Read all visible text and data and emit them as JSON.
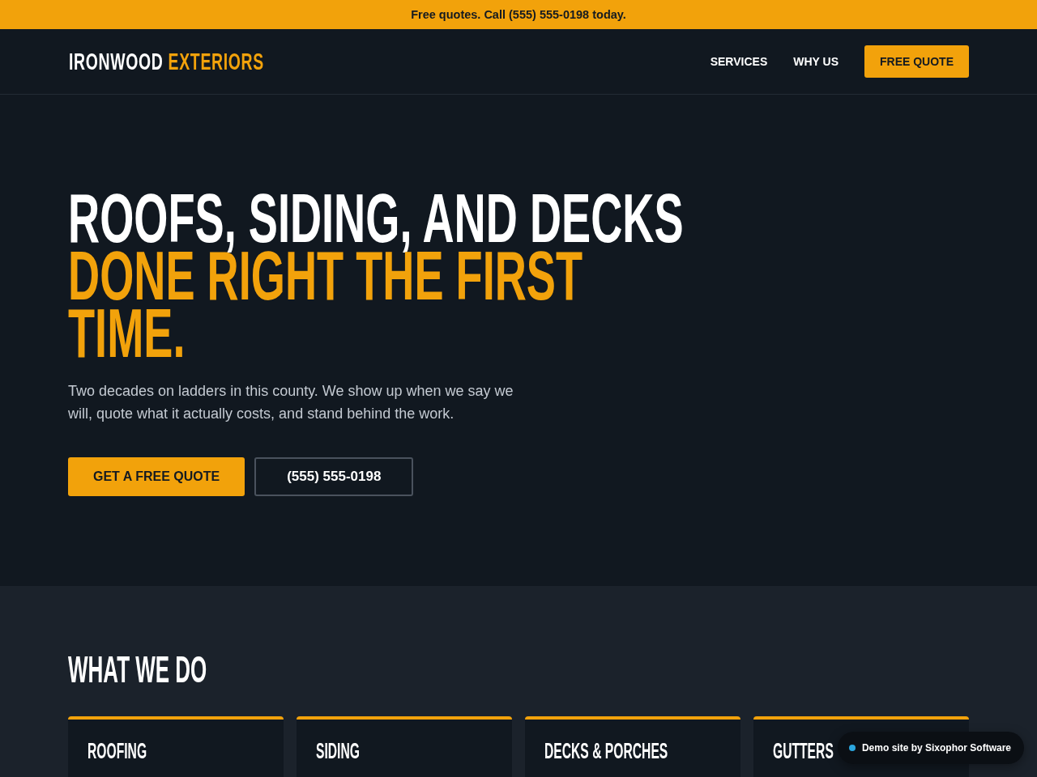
{
  "announcement_bar": {
    "text": "Free quotes. Call (555) 555-0198 today."
  },
  "header": {
    "logo": {
      "primary": "IRONWOOD",
      "accent": "EXTERIORS"
    },
    "nav": [
      {
        "label": "SERVICES",
        "kind": "link"
      },
      {
        "label": "WHY US",
        "kind": "link"
      },
      {
        "label": "FREE QUOTE",
        "kind": "button"
      }
    ]
  },
  "hero": {
    "headline": "ROOFS, SIDING, AND DECKS",
    "headline_highlight": "DONE RIGHT THE FIRST TIME.",
    "description": "Two decades on ladders in this county. We show up when we say we will, quote what it actually costs, and stand behind the work.",
    "actions": [
      {
        "label": "GET A FREE QUOTE",
        "kind": "primary"
      },
      {
        "label": "(555) 555-0198",
        "kind": "outline"
      }
    ]
  },
  "services": {
    "heading": "WHAT WE DO",
    "cards": [
      {
        "title": "ROOFING"
      },
      {
        "title": "SIDING"
      },
      {
        "title": "DECKS & PORCHES"
      },
      {
        "title": "GUTTERS"
      }
    ]
  },
  "demo_badge": {
    "text": "Demo site by Sixophor Software"
  }
}
